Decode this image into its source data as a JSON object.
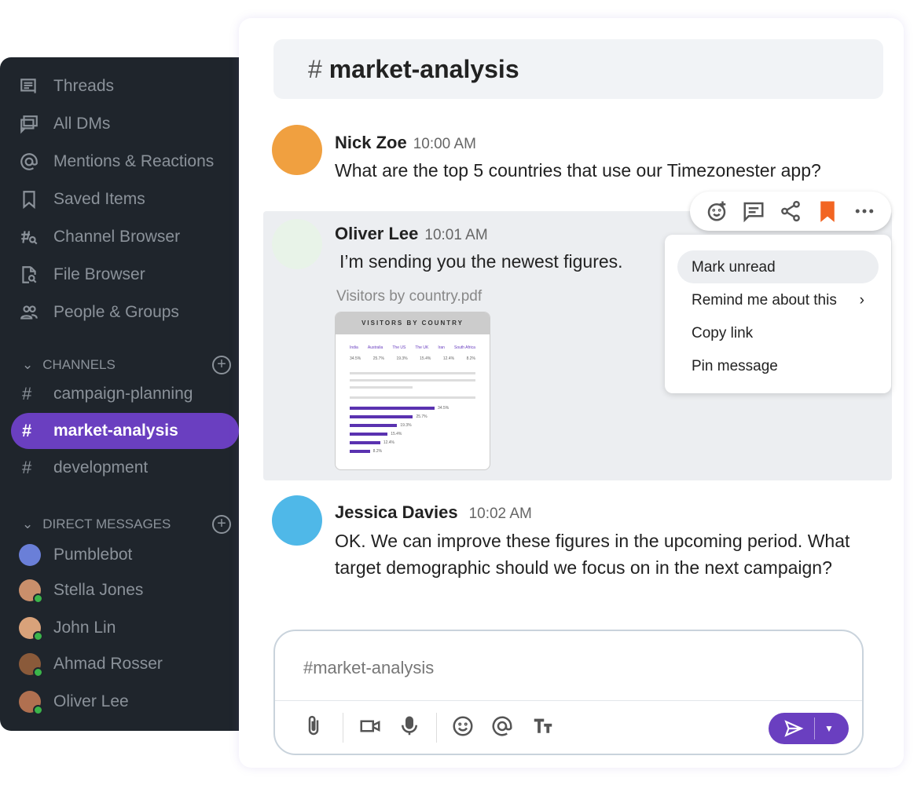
{
  "sidebar": {
    "nav": [
      {
        "label": "Threads",
        "icon": "threads-icon"
      },
      {
        "label": "All DMs",
        "icon": "dms-icon"
      },
      {
        "label": "Mentions & Reactions",
        "icon": "at-icon"
      },
      {
        "label": "Saved Items",
        "icon": "bookmark-icon"
      },
      {
        "label": "Channel Browser",
        "icon": "channel-search-icon"
      },
      {
        "label": "File Browser",
        "icon": "file-search-icon"
      },
      {
        "label": "People & Groups",
        "icon": "people-icon"
      }
    ],
    "channels_label": "CHANNELS",
    "channels": [
      {
        "label": "campaign-planning"
      },
      {
        "label": "market-analysis",
        "active": true
      },
      {
        "label": "development"
      }
    ],
    "dms_label": "DIRECT MESSAGES",
    "dms": [
      {
        "label": "Pumblebot",
        "color": "#6a7fd8"
      },
      {
        "label": "Stella Jones",
        "color": "#c98f6b"
      },
      {
        "label": "John Lin",
        "color": "#d9a27a"
      },
      {
        "label": "Ahmad Rosser",
        "color": "#8a5a3a"
      },
      {
        "label": "Oliver Lee",
        "color": "#b07050"
      }
    ]
  },
  "channel": {
    "hash": "#",
    "name": "market-analysis"
  },
  "messages": [
    {
      "author": "Nick Zoe",
      "time": "10:00 AM",
      "text": "What are the top 5 countries that use our Timezonester app?"
    },
    {
      "author": "Oliver Lee",
      "time": "10:01 AM",
      "text": "I’m sending you the newest figures.",
      "attachment": "Visitors by country.pdf"
    },
    {
      "author": "Jessica Davies",
      "time": "10:02 AM",
      "text": "OK. We can improve these figures in the upcoming period. What target demographic should we focus on in the next campaign?"
    }
  ],
  "pdf": {
    "title": "VISITORS BY COUNTRY",
    "countries": [
      "India",
      "Australia",
      "The US",
      "The UK",
      "Iran",
      "South Africa"
    ],
    "values": [
      "34.5%",
      "25.7%",
      "19.3%",
      "15.4%",
      "12.4%",
      "8.2%"
    ],
    "bars": [
      34.5,
      25.7,
      19.3,
      15.4,
      12.4,
      8.2
    ]
  },
  "context_menu": {
    "items": [
      "Mark unread",
      "Remind me about this",
      "Copy link",
      "Pin message"
    ],
    "arrow": "›"
  },
  "composer": {
    "placeholder": "#market-analysis"
  },
  "colors": {
    "accent": "#6a3fc0",
    "bookmark": "#f26522",
    "sidebar": "#1f252c"
  }
}
